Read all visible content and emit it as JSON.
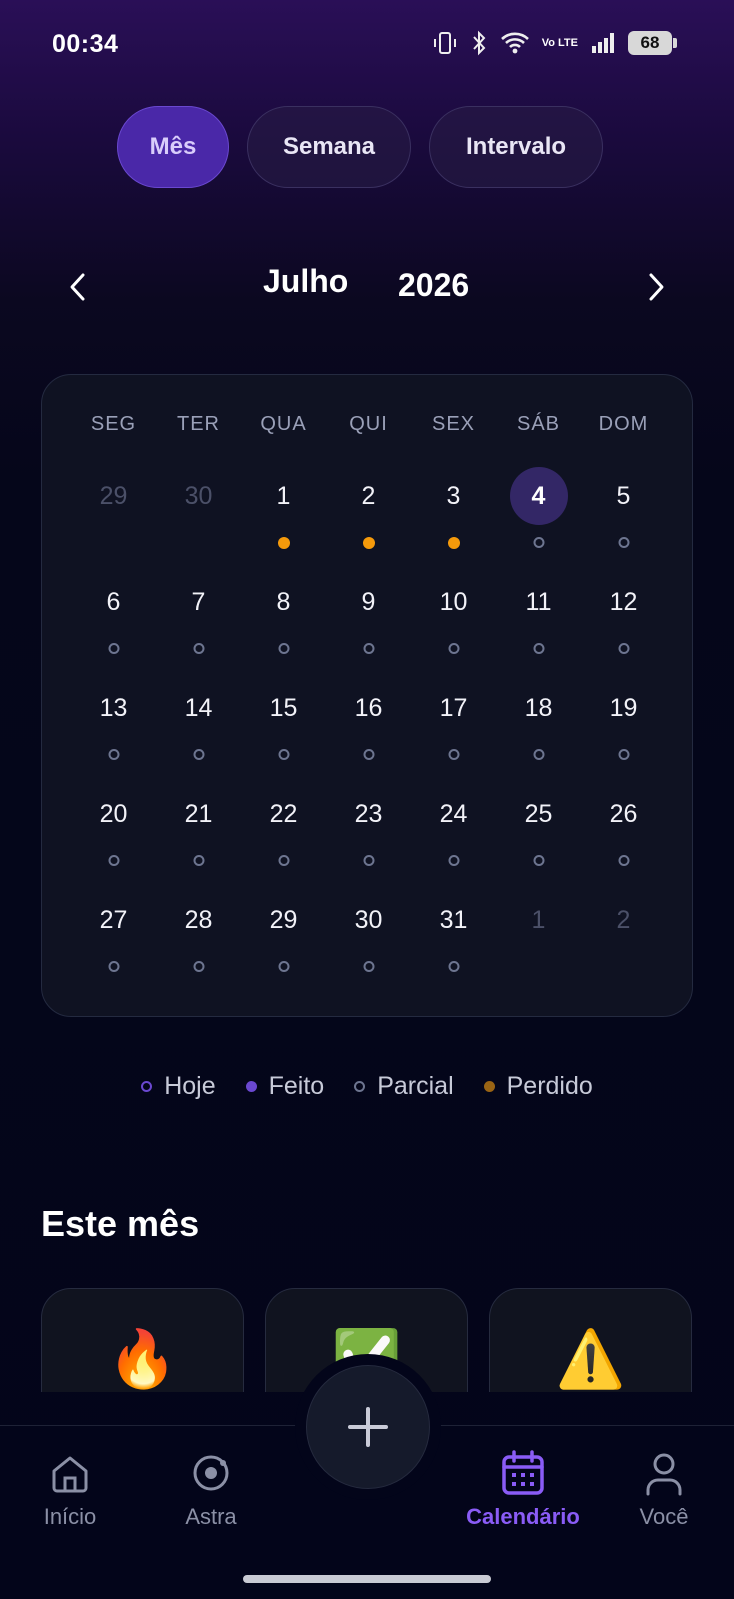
{
  "status_bar": {
    "time": "00:34",
    "battery": "68",
    "volte": "Vo LTE"
  },
  "view_tabs": [
    {
      "label": "Mês",
      "active": true
    },
    {
      "label": "Semana",
      "active": false
    },
    {
      "label": "Intervalo",
      "active": false
    }
  ],
  "month_nav": {
    "month": "Julho",
    "year": "2026"
  },
  "weekdays": [
    "SEG",
    "TER",
    "QUA",
    "QUI",
    "SEX",
    "SÁB",
    "DOM"
  ],
  "weeks": [
    [
      {
        "day": "29",
        "muted": true,
        "status": "none"
      },
      {
        "day": "30",
        "muted": true,
        "status": "none"
      },
      {
        "day": "1",
        "status": "missed"
      },
      {
        "day": "2",
        "status": "missed"
      },
      {
        "day": "3",
        "status": "missed"
      },
      {
        "day": "4",
        "today": true,
        "status": "partial"
      },
      {
        "day": "5",
        "status": "partial"
      }
    ],
    [
      {
        "day": "6",
        "status": "partial"
      },
      {
        "day": "7",
        "status": "partial"
      },
      {
        "day": "8",
        "status": "partial"
      },
      {
        "day": "9",
        "status": "partial"
      },
      {
        "day": "10",
        "status": "partial"
      },
      {
        "day": "11",
        "status": "partial"
      },
      {
        "day": "12",
        "status": "partial"
      }
    ],
    [
      {
        "day": "13",
        "status": "partial"
      },
      {
        "day": "14",
        "status": "partial"
      },
      {
        "day": "15",
        "status": "partial"
      },
      {
        "day": "16",
        "status": "partial"
      },
      {
        "day": "17",
        "status": "partial"
      },
      {
        "day": "18",
        "status": "partial"
      },
      {
        "day": "19",
        "status": "partial"
      }
    ],
    [
      {
        "day": "20",
        "status": "partial"
      },
      {
        "day": "21",
        "status": "partial"
      },
      {
        "day": "22",
        "status": "partial"
      },
      {
        "day": "23",
        "status": "partial"
      },
      {
        "day": "24",
        "status": "partial"
      },
      {
        "day": "25",
        "status": "partial"
      },
      {
        "day": "26",
        "status": "partial"
      }
    ],
    [
      {
        "day": "27",
        "status": "partial"
      },
      {
        "day": "28",
        "status": "partial"
      },
      {
        "day": "29",
        "status": "partial"
      },
      {
        "day": "30",
        "status": "partial"
      },
      {
        "day": "31",
        "status": "partial"
      },
      {
        "day": "1",
        "muted": true,
        "status": "none"
      },
      {
        "day": "2",
        "muted": true,
        "status": "none"
      }
    ]
  ],
  "legend": {
    "hoje": "Hoje",
    "feito": "Feito",
    "parcial": "Parcial",
    "perdido": "Perdido"
  },
  "section": {
    "title": "Este mês"
  },
  "summary_cards": [
    {
      "icon": "🔥",
      "icon_name": "fire-icon"
    },
    {
      "icon": "✅",
      "icon_name": "check-mark-icon"
    },
    {
      "icon": "⚠️",
      "icon_name": "warning-icon"
    }
  ],
  "bottom_nav": {
    "inicio": "Início",
    "astra": "Astra",
    "calendario": "Calendário",
    "voce": "Você"
  },
  "colors": {
    "accent": "#8a5cf6",
    "missed": "#f59a0b",
    "active_tab": "#4a28a8"
  }
}
